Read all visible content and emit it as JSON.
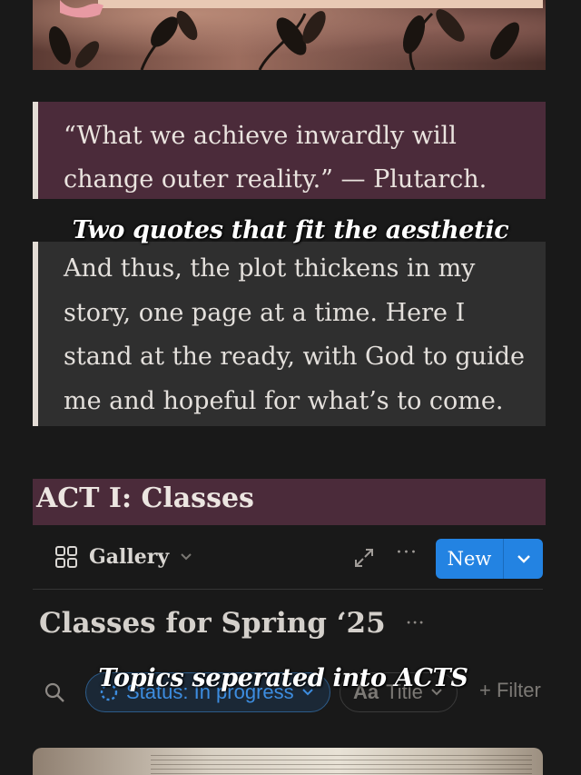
{
  "cover": {
    "image": "botanical-library-collage"
  },
  "quotes": {
    "first": {
      "line1": "“What we achieve inwardly will",
      "line2": "change outer reality.” — Plutarch."
    },
    "second": {
      "line1": "And thus, the plot thickens in my",
      "line2": "story, one page at a time. Here I",
      "line3": "stand at the ready, with God to guide",
      "line4": "me and hopeful for what’s to come."
    }
  },
  "overlays": {
    "quotes_caption": "Two quotes that fit the aesthetic",
    "acts_caption": "Topics seperated into ACTS"
  },
  "act": {
    "heading": "ACT I: Classes"
  },
  "database": {
    "view_label": "Gallery",
    "new_label": "New",
    "title": "Classes for Spring ‘25",
    "title_more": "···",
    "more": "···"
  },
  "filters": {
    "status_chip": "Status: In progress",
    "title_chip_aa": "Aa",
    "title_chip_label": "Title",
    "add_filter": "+ Filter"
  },
  "colors": {
    "background": "#191919",
    "callout": "#4b2b3a",
    "accent_blue": "#2383e2"
  }
}
